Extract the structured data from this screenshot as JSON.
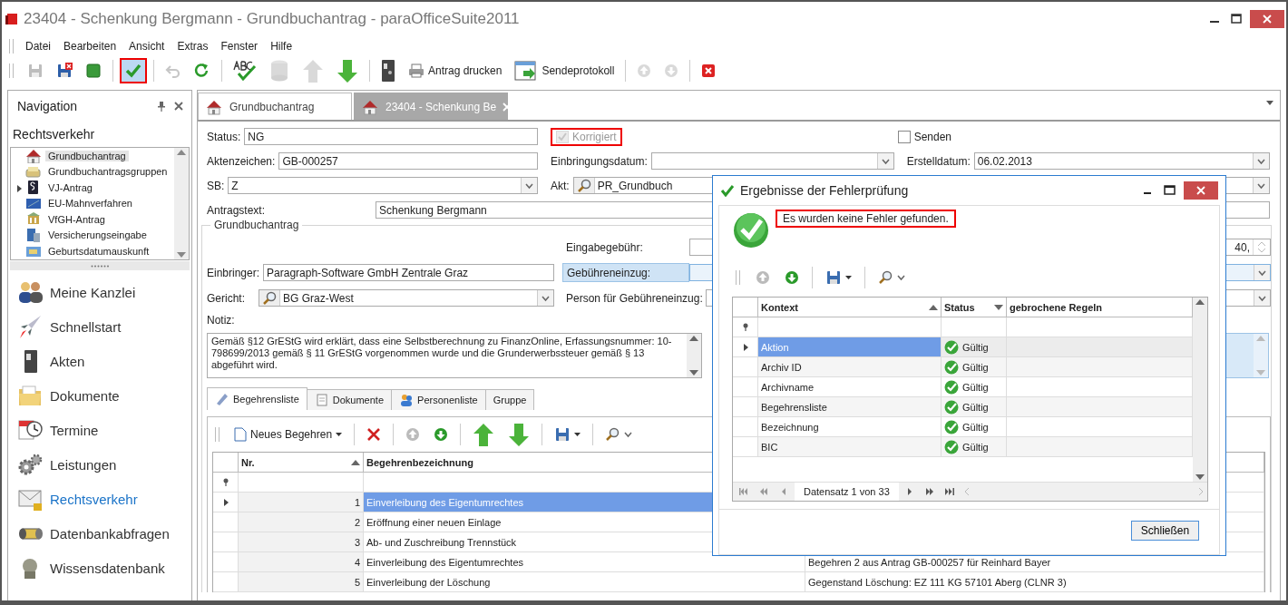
{
  "window": {
    "title": "23404 - Schenkung Bergmann - Grundbuchantrag - paraOfficeSuite2011"
  },
  "menu": [
    "Datei",
    "Bearbeiten",
    "Ansicht",
    "Extras",
    "Fenster",
    "Hilfe"
  ],
  "toolbar": [
    {
      "kind": "icon",
      "disabled": true
    },
    {
      "kind": "icon",
      "disabled": false
    },
    {
      "kind": "icon",
      "disabled": false
    },
    {
      "kind": "separator"
    },
    {
      "kind": "icon",
      "disabled": false,
      "highlighted": true
    },
    {
      "kind": "separator"
    },
    {
      "kind": "icon",
      "disabled": true
    },
    {
      "kind": "icon",
      "disabled": false
    },
    {
      "kind": "separator"
    },
    {
      "kind": "icon",
      "disabled": false
    },
    {
      "kind": "icon",
      "disabled": true
    },
    {
      "kind": "icon",
      "disabled": true
    },
    {
      "kind": "icon",
      "disabled": false
    },
    {
      "kind": "separator"
    },
    {
      "kind": "icon",
      "disabled": false
    },
    {
      "kind": "labeled",
      "label": "Antrag drucken",
      "disabled": false
    },
    {
      "kind": "labeled",
      "label": "Sendeprotokoll",
      "disabled": false
    },
    {
      "kind": "separator"
    },
    {
      "kind": "icon",
      "disabled": true
    },
    {
      "kind": "icon",
      "disabled": true
    },
    {
      "kind": "separator"
    },
    {
      "kind": "icon",
      "disabled": false
    }
  ],
  "navigation": {
    "title": "Navigation",
    "section": "Rechtsverkehr",
    "list": [
      {
        "label": "Grundbuchantrag",
        "selected": true
      },
      {
        "label": "Grundbuchantragsgruppen",
        "selected": false
      },
      {
        "label": "VJ-Antrag",
        "selected": false,
        "expanded": false
      },
      {
        "label": "EU-Mahnverfahren",
        "selected": false
      },
      {
        "label": "VfGH-Antrag",
        "selected": false
      },
      {
        "label": "Versicherungseingabe",
        "selected": false
      },
      {
        "label": "Geburtsdatumauskunft",
        "selected": false
      }
    ],
    "modules": [
      {
        "label": "Meine Kanzlei",
        "selected": false
      },
      {
        "label": "Schnellstart",
        "selected": false
      },
      {
        "label": "Akten",
        "selected": false
      },
      {
        "label": "Dokumente",
        "selected": false
      },
      {
        "label": "Termine",
        "selected": false
      },
      {
        "label": "Leistungen",
        "selected": false
      },
      {
        "label": "Rechtsverkehr",
        "selected": true
      },
      {
        "label": "Datenbankabfragen",
        "selected": false
      },
      {
        "label": "Wissensdatenbank",
        "selected": false
      }
    ]
  },
  "doc_tabs": [
    {
      "label": "Grundbuchantrag",
      "selected": false
    },
    {
      "label": "23404 - Schenkung Be",
      "selected": true
    }
  ],
  "form": {
    "status": {
      "label": "Status:",
      "value": "NG"
    },
    "korrigiert": {
      "label": "Korrigiert",
      "checked": true,
      "disabled": true,
      "highlighted": true
    },
    "senden": {
      "label": "Senden",
      "checked": false
    },
    "aktenzeichen": {
      "label": "Aktenzeichen:",
      "value": "GB-000257"
    },
    "einbringungsdatum": {
      "label": "Einbringungsdatum:"
    },
    "erstelldatum": {
      "label": "Erstelldatum:",
      "value": "06.02.2013"
    },
    "sb": {
      "label": "SB:",
      "value": "Z"
    },
    "akt": {
      "label": "Akt:",
      "value": "PR_Grundbuch"
    },
    "antragstext": {
      "label": "Antragstext:",
      "value": "Schenkung Bergmann"
    }
  },
  "group": {
    "title": "Grundbuchantrag",
    "eingabegebuehr": {
      "label": "Eingabegebühr:",
      "value": "40,"
    },
    "einbringer": {
      "label": "Einbringer:",
      "value": "Paragraph-Software GmbH Zentrale Graz"
    },
    "gebuehreneinzug": {
      "label": "Gebühreneinzug:",
      "focused": true
    },
    "gericht": {
      "label": "Gericht:",
      "value": "BG Graz-West"
    },
    "person": {
      "label": "Person für Gebühreneinzug:"
    },
    "notiz": {
      "label": "Notiz:",
      "value": "Gemäß §12 GrEStG wird erklärt, dass eine Selbstberechnung zu FinanzOnline, Erfassungsnummer: 10-798699/2013 gemäß § 11 GrEStG vorgenommen wurde und die Grunderwerbssteuer gemäß § 13 abgeführt wird."
    }
  },
  "sub_tabs": [
    {
      "label": "Begehrensliste",
      "selected": true
    },
    {
      "label": "Dokumente",
      "selected": false
    },
    {
      "label": "Personenliste",
      "selected": false
    },
    {
      "label": "Gruppe",
      "selected": false
    }
  ],
  "sub_toolbar": {
    "new_label": "Neues Begehren"
  },
  "table": {
    "columns": [
      "Nr.",
      "Begehrenbezeichnung"
    ],
    "rows": [
      {
        "nr": "1",
        "bezeichnung": "Einverleibung des Eigentumrechtes",
        "selected": true
      },
      {
        "nr": "2",
        "bezeichnung": "Eröffnung einer neuen Einlage",
        "selected": false
      },
      {
        "nr": "3",
        "bezeichnung": "Ab- und Zuschreibung Trennstück",
        "selected": false
      },
      {
        "nr": "4",
        "bezeichnung": "Einverleibung des Eigentumrechtes",
        "column_3": "Begehren 2 aus Antrag GB-000257 für Reinhard Bayer",
        "selected": false
      },
      {
        "nr": "5",
        "bezeichnung": "Einverleibung der Löschung",
        "column_3": "Gegenstand Löschung: EZ 111 KG 57101 Aberg (CLNR 3)",
        "selected": false
      }
    ]
  },
  "dialog": {
    "title": "Ergebnisse der Fehlerprüfung",
    "message": "Es wurden keine Fehler gefunden.",
    "columns": [
      "Kontext",
      "Status",
      "gebrochene Regeln"
    ],
    "rows": [
      {
        "kontext": "Aktion",
        "status": "Gültig",
        "selected": true
      },
      {
        "kontext": "Archiv ID",
        "status": "Gültig",
        "selected": false
      },
      {
        "kontext": "Archivname",
        "status": "Gültig",
        "selected": false
      },
      {
        "kontext": "Begehrensliste",
        "status": "Gültig",
        "selected": false
      },
      {
        "kontext": "Bezeichnung",
        "status": "Gültig",
        "selected": false
      },
      {
        "kontext": "BIC",
        "status": "Gültig",
        "selected": false
      }
    ],
    "navigator": "Datensatz 1 von 33",
    "close_button": "Schließen"
  }
}
